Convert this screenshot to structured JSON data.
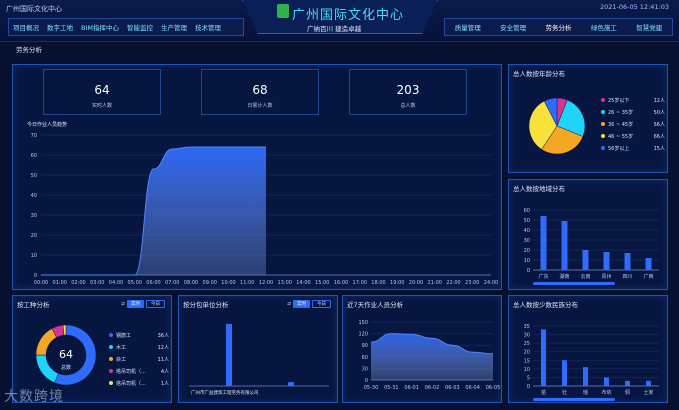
{
  "header": {
    "left_label": "广州国际文化中心",
    "title": "广州国际文化中心",
    "subtitle": "广纳百川 建造卓越",
    "datetime": "2021-06-05  12:41:03",
    "nav_left": [
      "项目概况",
      "数字工地",
      "BIM指挥中心",
      "智能监控",
      "生产管理",
      "技术管理"
    ],
    "nav_right": [
      "质量管理",
      "安全管理",
      "劳务分析",
      "绿色施工",
      "智慧党建"
    ],
    "active_nav": "劳务分析",
    "page_tab": "劳务分析"
  },
  "colors": {
    "accent": "#3fe0ff",
    "bar": "#2f6bff",
    "panel_border": "#1f55b5"
  },
  "main_panel": {
    "stats": [
      {
        "value": "64",
        "label": "实时人数"
      },
      {
        "value": "68",
        "label": "日累计人数"
      },
      {
        "value": "203",
        "label": "总人数"
      }
    ],
    "chart_label": "今日作业人员趋势"
  },
  "age_panel": {
    "title": "总人数按年龄分布",
    "legend": [
      {
        "label": "25岁以下",
        "value": "12人",
        "color": "#d7338f"
      },
      {
        "label": "26 ~ 35岁",
        "value": "50人",
        "color": "#1fd4f7"
      },
      {
        "label": "36 ~ 45岁",
        "value": "56人",
        "color": "#f5a623"
      },
      {
        "label": "46 ~ 55岁",
        "value": "66人",
        "color": "#f8e23b"
      },
      {
        "label": "56岁以上",
        "value": "15人",
        "color": "#2f6bff"
      }
    ]
  },
  "region_panel": {
    "title": "总人数按地域分布"
  },
  "type_panel": {
    "title": "按工种分析",
    "toggle": [
      "实时",
      "今日"
    ],
    "donut_value": "64",
    "donut_label": "总数",
    "legend": [
      {
        "label": "钢筋工",
        "value": "36人",
        "color": "#2f6bff"
      },
      {
        "label": "木工",
        "value": "12人",
        "color": "#1fd4f7"
      },
      {
        "label": "杂工",
        "value": "11人",
        "color": "#f5a623"
      },
      {
        "label": "塔吊司机（...",
        "value": "4人",
        "color": "#d7338f"
      },
      {
        "label": "塔吊司机（...",
        "value": "1人",
        "color": "#f8e23b"
      }
    ]
  },
  "contract_panel": {
    "title": "按分包单位分析",
    "toggle": [
      "实时",
      "今日"
    ],
    "company": "广州市广益建筑工程劳务有限公司"
  },
  "week_panel": {
    "title": "近7天作业人员分析"
  },
  "dept_panel": {
    "title": "总人数按少数民族分布"
  },
  "watermark": "大数跨境",
  "chart_data": [
    {
      "type": "area",
      "title": "今日作业人员趋势",
      "x": [
        "00:00",
        "01:00",
        "02:00",
        "03:00",
        "04:00",
        "05:00",
        "06:00",
        "07:00",
        "08:00",
        "09:00",
        "10:00",
        "11:00",
        "12:00",
        "13:00",
        "14:00",
        "15:00",
        "16:00",
        "17:00",
        "18:00",
        "19:00",
        "20:00",
        "21:00",
        "22:00",
        "23:00",
        "24:00"
      ],
      "values": [
        0,
        0,
        0,
        0,
        0,
        0,
        53,
        63,
        64,
        64,
        64,
        64,
        64,
        null,
        null,
        null,
        null,
        null,
        null,
        null,
        null,
        null,
        null,
        null,
        null
      ],
      "y_ticks": [
        0,
        10,
        20,
        30,
        40,
        50,
        60,
        70
      ],
      "ylim": [
        0,
        70
      ]
    },
    {
      "type": "pie",
      "title": "总人数按年龄分布",
      "categories": [
        "25岁以下",
        "26 ~ 35岁",
        "36 ~ 45岁",
        "46 ~ 55岁",
        "56岁以上"
      ],
      "values": [
        12,
        50,
        56,
        66,
        15
      ]
    },
    {
      "type": "bar",
      "title": "总人数按地域分布",
      "categories": [
        "广东",
        "湖南",
        "云南",
        "贵州",
        "四川",
        "广西"
      ],
      "values": [
        54,
        49,
        20,
        18,
        17,
        12
      ],
      "y_ticks": [
        0,
        10,
        20,
        30,
        40,
        50,
        60
      ],
      "ylim": [
        0,
        60
      ]
    },
    {
      "type": "pie",
      "title": "按工种分析",
      "categories": [
        "钢筋工",
        "木工",
        "杂工",
        "塔吊司机（...",
        "塔吊司机（..."
      ],
      "values": [
        36,
        12,
        11,
        4,
        1
      ]
    },
    {
      "type": "bar",
      "title": "按分包单位分析",
      "categories": [
        "广州市广益建筑工程劳务有限公司",
        ""
      ],
      "values": [
        64,
        4
      ],
      "ylim": [
        0,
        70
      ]
    },
    {
      "type": "area",
      "title": "近7天作业人员分析",
      "x": [
        "05-30",
        "05-31",
        "06-01",
        "06-02",
        "06-03",
        "06-04",
        "06-05"
      ],
      "values": [
        98,
        120,
        118,
        108,
        90,
        72,
        68
      ],
      "y_ticks": [
        0,
        30,
        60,
        90,
        120,
        150
      ],
      "ylim": [
        0,
        150
      ]
    },
    {
      "type": "bar",
      "title": "总人数按少数民族分布",
      "categories": [
        "苗",
        "壮",
        "瑶",
        "布依",
        "侗",
        "土家"
      ],
      "values": [
        33,
        15,
        11,
        5,
        3,
        3
      ],
      "y_ticks": [
        0,
        5,
        10,
        15,
        20,
        25,
        30,
        35
      ],
      "ylim": [
        0,
        35
      ]
    }
  ]
}
